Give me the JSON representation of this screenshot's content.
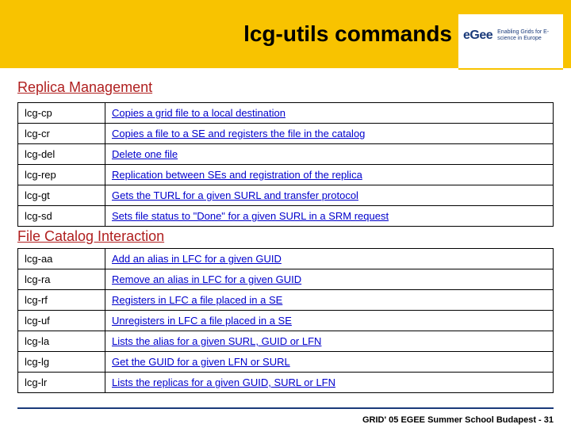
{
  "header": {
    "title": "lcg-utils commands",
    "logo_main": "eGee",
    "logo_tag": "Enabling Grids for E-science in Europe"
  },
  "section1": {
    "heading": "Replica Management",
    "rows": [
      {
        "cmd": "lcg-cp",
        "desc": "Copies a grid file to a local destination"
      },
      {
        "cmd": "lcg-cr",
        "desc": "Copies a file to a SE and registers the file in the catalog"
      },
      {
        "cmd": "lcg-del",
        "desc": "Delete one file"
      },
      {
        "cmd": "lcg-rep",
        "desc": "Replication between SEs and registration of the replica"
      },
      {
        "cmd": "lcg-gt",
        "desc": "Gets the TURL for a given SURL and transfer protocol"
      },
      {
        "cmd": "lcg-sd",
        "desc": "Sets file status to \"Done\" for a given SURL in a SRM request"
      }
    ]
  },
  "section2": {
    "heading": "File Catalog Interaction",
    "rows": [
      {
        "cmd": "lcg-aa",
        "desc": "Add an alias in LFC for a given GUID"
      },
      {
        "cmd": "lcg-ra",
        "desc": "Remove an alias in LFC for a given GUID"
      },
      {
        "cmd": "lcg-rf",
        "desc": "Registers in LFC a file placed in a SE"
      },
      {
        "cmd": "lcg-uf",
        "desc": "Unregisters in LFC a file placed in a SE"
      },
      {
        "cmd": "lcg-la",
        "desc": "Lists the alias for a given SURL, GUID or LFN"
      },
      {
        "cmd": "lcg-lg",
        "desc": "Get the GUID for a given LFN or SURL"
      },
      {
        "cmd": "lcg-lr",
        "desc": "Lists the replicas for a given GUID, SURL or LFN"
      }
    ]
  },
  "footer": {
    "text": "GRID' 05 EGEE Summer School Budapest - 31"
  }
}
